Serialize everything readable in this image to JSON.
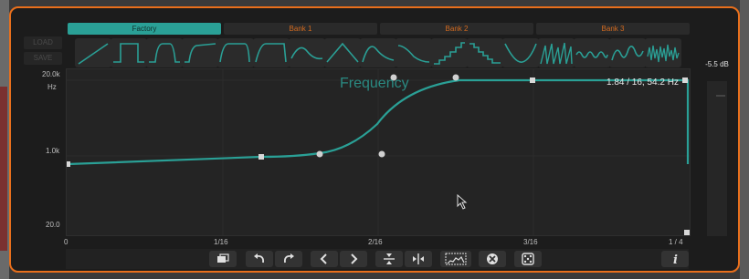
{
  "colors": {
    "accent": "#2aa096",
    "border": "#e86f1c",
    "tab_text": "#d26a20"
  },
  "side_buttons": {
    "load": "LOAD",
    "save": "SAVE"
  },
  "bank_tabs": [
    {
      "label": "Factory",
      "active": true
    },
    {
      "label": "Bank 1",
      "active": false
    },
    {
      "label": "Bank 2",
      "active": false
    },
    {
      "label": "Bank 3",
      "active": false
    }
  ],
  "shape_presets": [
    "ramp-up",
    "square",
    "soft-step",
    "rise",
    "plateau",
    "trapezoid",
    "sine",
    "triangle",
    "bump",
    "decay",
    "steps-up",
    "steps-down",
    "v-curve",
    "saw-burst",
    "wobble",
    "multi-bump",
    "noise"
  ],
  "graph": {
    "title": "Frequency",
    "y_ticks": [
      "20.0k",
      "Hz",
      "1.0k",
      "20.0"
    ],
    "x_ticks": [
      "0",
      "1/16",
      "2/16",
      "3/16",
      "1 / 4"
    ],
    "readout": "1.84 / 16,  54.2 Hz"
  },
  "meter": {
    "value": "-5.5 dB"
  },
  "toolbar_icons": [
    "copy-window-icon",
    "undo-icon",
    "redo-icon",
    "prev-icon",
    "next-icon",
    "compress-vertical-icon",
    "expand-horizontal-icon",
    "spectrum-icon",
    "clear-icon",
    "random-dice-icon",
    "info-icon"
  ]
}
